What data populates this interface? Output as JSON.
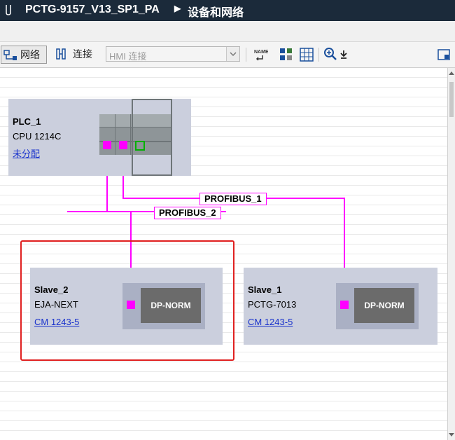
{
  "title": {
    "project": "PCTG-9157_V13_SP1_PA",
    "page": "设备和网络"
  },
  "toolbar": {
    "network_label": "网络",
    "connect_label": "连接",
    "connection_type": "HMI 连接"
  },
  "devices": {
    "plc": {
      "name": "PLC_1",
      "type": "CPU 1214C",
      "link": "未分配"
    },
    "slave2": {
      "name": "Slave_2",
      "type": "EJA-NEXT",
      "link": "CM 1243-5",
      "module": "DP-NORM"
    },
    "slave1": {
      "name": "Slave_1",
      "type": "PCTG-7013",
      "link": "CM 1243-5",
      "module": "DP-NORM"
    }
  },
  "networks": {
    "net1": "PROFIBUS_1",
    "net2": "PROFIBUS_2"
  },
  "colors": {
    "profibus": "#ff00ff",
    "selection": "#e02020",
    "titlebar": "#1b2a3a"
  }
}
